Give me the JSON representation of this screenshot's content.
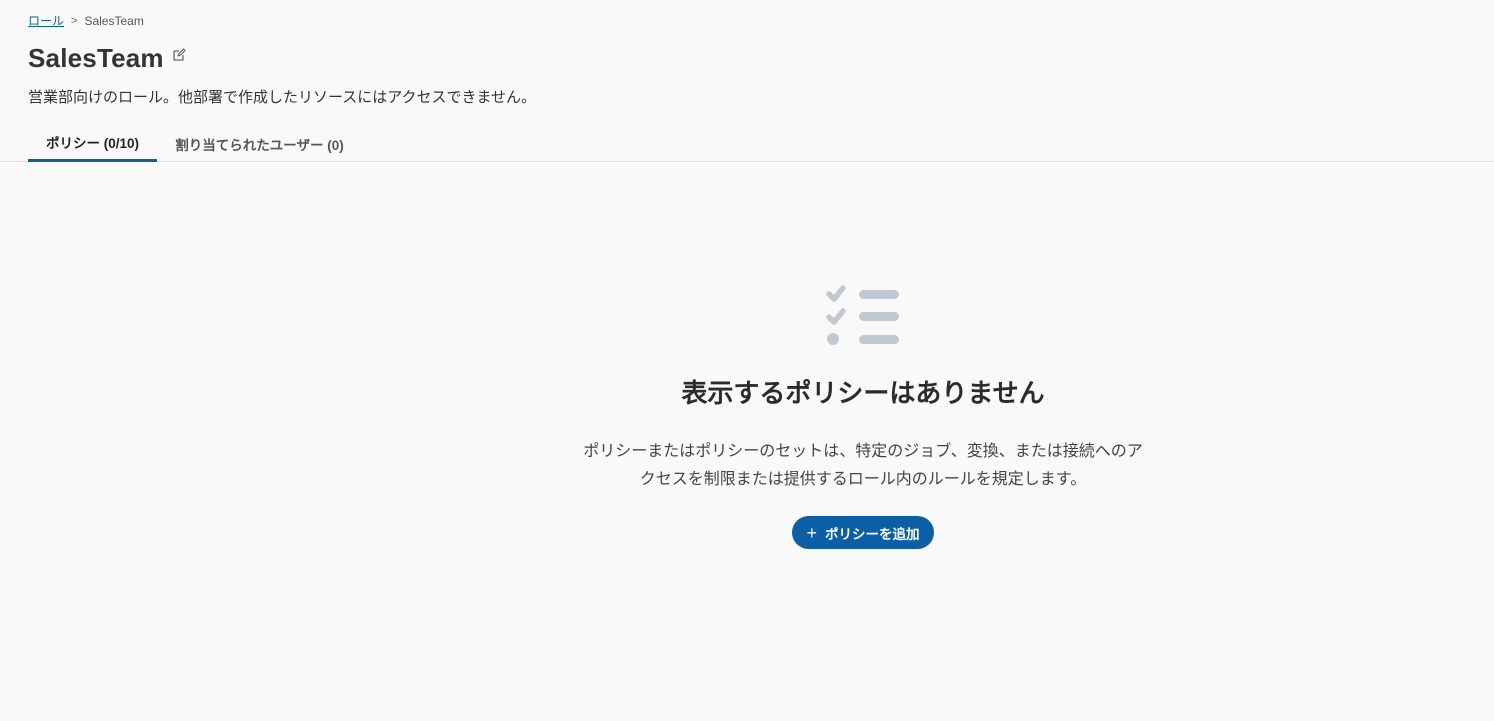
{
  "breadcrumb": {
    "parent_label": "ロール",
    "separator": ">",
    "current_label": "SalesTeam"
  },
  "header": {
    "title": "SalesTeam",
    "description": "営業部向けのロール。他部署で作成したリソースにはアクセスできません。"
  },
  "tabs": [
    {
      "label": "ポリシー (0/10)",
      "active": true
    },
    {
      "label": "割り当てられたユーザー (0)",
      "active": false
    }
  ],
  "empty_state": {
    "icon": "checklist-icon",
    "title": "表示するポリシーはありません",
    "description": "ポリシーまたはポリシーのセットは、特定のジョブ、変換、または接続へのアクセスを制限または提供するロール内のルールを規定します。",
    "button_label": "ポリシーを追加",
    "button_icon": "plus-icon"
  },
  "colors": {
    "accent": "#0b5fa5",
    "background": "#f9f9f9",
    "icon_gray": "#c0c9d2"
  }
}
